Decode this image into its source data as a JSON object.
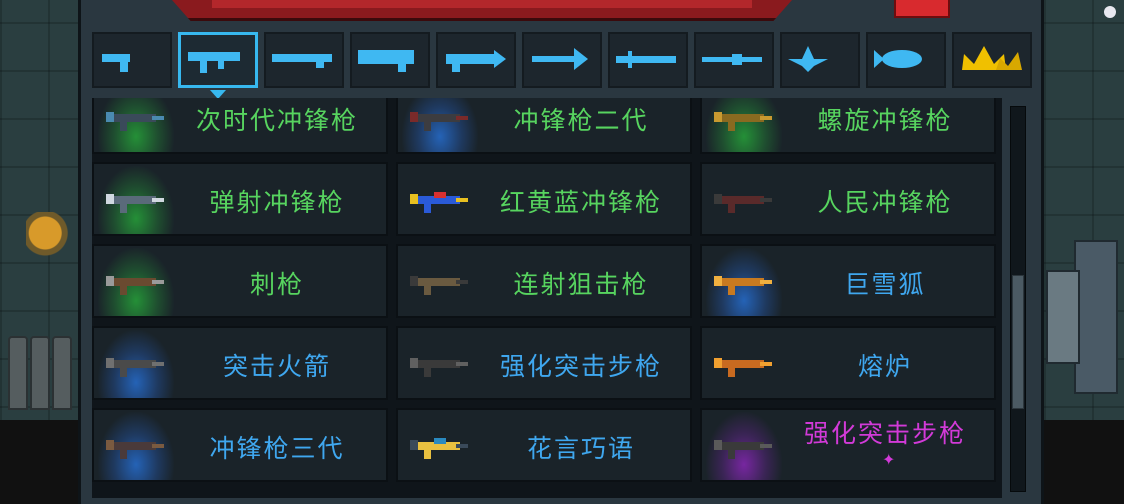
{
  "tabs": [
    {
      "icon": "pistol-icon",
      "color": "#3fb8f2"
    },
    {
      "icon": "smg-icon",
      "color": "#3fb8f2",
      "active": true
    },
    {
      "icon": "rifle-icon",
      "color": "#3fb8f2"
    },
    {
      "icon": "shotgun-icon",
      "color": "#3fb8f2"
    },
    {
      "icon": "laser-gun-icon",
      "color": "#3fb8f2"
    },
    {
      "icon": "bow-icon",
      "color": "#3fb8f2"
    },
    {
      "icon": "sword-icon",
      "color": "#3fb8f2"
    },
    {
      "icon": "spear-icon",
      "color": "#3fb8f2"
    },
    {
      "icon": "shuriken-icon",
      "color": "#3fb8f2"
    },
    {
      "icon": "fish-icon",
      "color": "#3fb8f2"
    },
    {
      "icon": "crown-icon",
      "color": "#f0c000"
    }
  ],
  "weapons": [
    {
      "name": "次时代冲锋枪",
      "rarity": "green",
      "icon": "smg-next-gen-icon"
    },
    {
      "name": "冲锋枪二代",
      "rarity": "blue",
      "name_color": "green",
      "icon": "smg-gen2-icon"
    },
    {
      "name": "螺旋冲锋枪",
      "rarity": "green",
      "icon": "spiral-smg-icon"
    },
    {
      "name": "弹射冲锋枪",
      "rarity": "green",
      "icon": "bounce-smg-icon"
    },
    {
      "name": "红黄蓝冲锋枪",
      "rarity": "none",
      "name_color": "green",
      "icon": "rgb-smg-icon"
    },
    {
      "name": "人民冲锋枪",
      "rarity": "none",
      "name_color": "green",
      "icon": "people-smg-icon"
    },
    {
      "name": "刺枪",
      "rarity": "green",
      "icon": "bayonet-gun-icon"
    },
    {
      "name": "连射狙击枪",
      "rarity": "none",
      "name_color": "green",
      "icon": "rapid-sniper-icon"
    },
    {
      "name": "巨雪狐",
      "rarity": "blue",
      "icon": "snow-fox-icon"
    },
    {
      "name": "突击火箭",
      "rarity": "blue",
      "icon": "assault-rocket-icon"
    },
    {
      "name": "强化突击步枪",
      "rarity": "none",
      "name_color": "blue",
      "icon": "enhanced-rifle-icon"
    },
    {
      "name": "熔炉",
      "rarity": "none",
      "name_color": "blue",
      "icon": "furnace-gun-icon"
    },
    {
      "name": "冲锋枪三代",
      "rarity": "blue",
      "icon": "smg-gen3-icon"
    },
    {
      "name": "花言巧语",
      "rarity": "none",
      "name_color": "blue",
      "icon": "sweet-talk-icon"
    },
    {
      "name": "强化突击步枪",
      "rarity": "purple",
      "icon": "enhanced-rifle-purple-icon",
      "marker": "✦"
    }
  ]
}
